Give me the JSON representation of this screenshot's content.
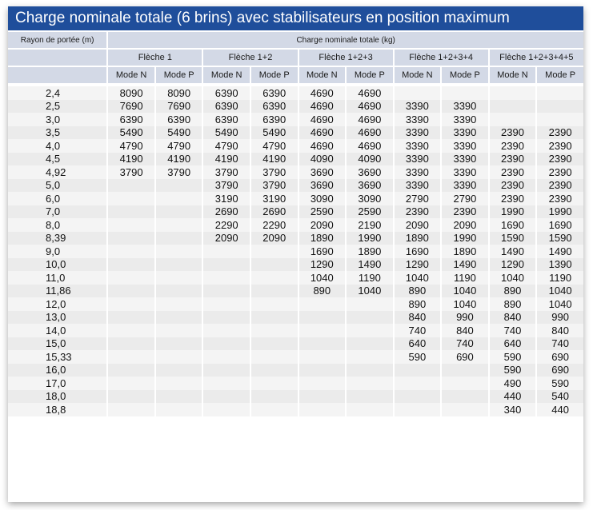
{
  "title": "Charge nominale totale (6 brins) avec stabilisateurs en position maximum",
  "header": {
    "radius_label": "Rayon de portée (m)",
    "load_label": "Charge nominale totale (kg)",
    "booms": [
      "Flèche 1",
      "Flèche 1+2",
      "Flèche 1+2+3",
      "Flèche 1+2+3+4",
      "Flèche 1+2+3+4+5"
    ],
    "modes": [
      "Mode N",
      "Mode P"
    ]
  },
  "table_rows": [
    {
      "radius": "2,4",
      "values": [
        "8090",
        "8090",
        "6390",
        "6390",
        "4690",
        "4690",
        "",
        "",
        "",
        ""
      ]
    },
    {
      "radius": "2,5",
      "values": [
        "7690",
        "7690",
        "6390",
        "6390",
        "4690",
        "4690",
        "3390",
        "3390",
        "",
        ""
      ]
    },
    {
      "radius": "3,0",
      "values": [
        "6390",
        "6390",
        "6390",
        "6390",
        "4690",
        "4690",
        "3390",
        "3390",
        "",
        ""
      ]
    },
    {
      "radius": "3,5",
      "values": [
        "5490",
        "5490",
        "5490",
        "5490",
        "4690",
        "4690",
        "3390",
        "3390",
        "2390",
        "2390"
      ]
    },
    {
      "radius": "4,0",
      "values": [
        "4790",
        "4790",
        "4790",
        "4790",
        "4690",
        "4690",
        "3390",
        "3390",
        "2390",
        "2390"
      ]
    },
    {
      "radius": "4,5",
      "values": [
        "4190",
        "4190",
        "4190",
        "4190",
        "4090",
        "4090",
        "3390",
        "3390",
        "2390",
        "2390"
      ]
    },
    {
      "radius": "4,92",
      "values": [
        "3790",
        "3790",
        "3790",
        "3790",
        "3690",
        "3690",
        "3390",
        "3390",
        "2390",
        "2390"
      ]
    },
    {
      "radius": "5,0",
      "values": [
        "",
        "",
        "3790",
        "3790",
        "3690",
        "3690",
        "3390",
        "3390",
        "2390",
        "2390"
      ]
    },
    {
      "radius": "6,0",
      "values": [
        "",
        "",
        "3190",
        "3190",
        "3090",
        "3090",
        "2790",
        "2790",
        "2390",
        "2390"
      ]
    },
    {
      "radius": "7,0",
      "values": [
        "",
        "",
        "2690",
        "2690",
        "2590",
        "2590",
        "2390",
        "2390",
        "1990",
        "1990"
      ]
    },
    {
      "radius": "8,0",
      "values": [
        "",
        "",
        "2290",
        "2290",
        "2090",
        "2190",
        "2090",
        "2090",
        "1690",
        "1690"
      ]
    },
    {
      "radius": "8,39",
      "values": [
        "",
        "",
        "2090",
        "2090",
        "1890",
        "1990",
        "1890",
        "1990",
        "1590",
        "1590"
      ]
    },
    {
      "radius": "9,0",
      "values": [
        "",
        "",
        "",
        "",
        "1690",
        "1890",
        "1690",
        "1890",
        "1490",
        "1490"
      ]
    },
    {
      "radius": "10,0",
      "values": [
        "",
        "",
        "",
        "",
        "1290",
        "1490",
        "1290",
        "1490",
        "1290",
        "1390"
      ]
    },
    {
      "radius": "11,0",
      "values": [
        "",
        "",
        "",
        "",
        "1040",
        "1190",
        "1040",
        "1190",
        "1040",
        "1190"
      ]
    },
    {
      "radius": "11,86",
      "values": [
        "",
        "",
        "",
        "",
        "890",
        "1040",
        "890",
        "1040",
        "890",
        "1040"
      ]
    },
    {
      "radius": "12,0",
      "values": [
        "",
        "",
        "",
        "",
        "",
        "",
        "890",
        "1040",
        "890",
        "1040"
      ]
    },
    {
      "radius": "13,0",
      "values": [
        "",
        "",
        "",
        "",
        "",
        "",
        "840",
        "990",
        "840",
        "990"
      ]
    },
    {
      "radius": "14,0",
      "values": [
        "",
        "",
        "",
        "",
        "",
        "",
        "740",
        "840",
        "740",
        "840"
      ]
    },
    {
      "radius": "15,0",
      "values": [
        "",
        "",
        "",
        "",
        "",
        "",
        "640",
        "740",
        "640",
        "740"
      ]
    },
    {
      "radius": "15,33",
      "values": [
        "",
        "",
        "",
        "",
        "",
        "",
        "590",
        "690",
        "590",
        "690"
      ]
    },
    {
      "radius": "16,0",
      "values": [
        "",
        "",
        "",
        "",
        "",
        "",
        "",
        "",
        "590",
        "690"
      ]
    },
    {
      "radius": "17,0",
      "values": [
        "",
        "",
        "",
        "",
        "",
        "",
        "",
        "",
        "490",
        "590"
      ]
    },
    {
      "radius": "18,0",
      "values": [
        "",
        "",
        "",
        "",
        "",
        "",
        "",
        "",
        "440",
        "540"
      ]
    },
    {
      "radius": "18,8",
      "values": [
        "",
        "",
        "",
        "",
        "",
        "",
        "",
        "",
        "340",
        "440"
      ]
    }
  ]
}
